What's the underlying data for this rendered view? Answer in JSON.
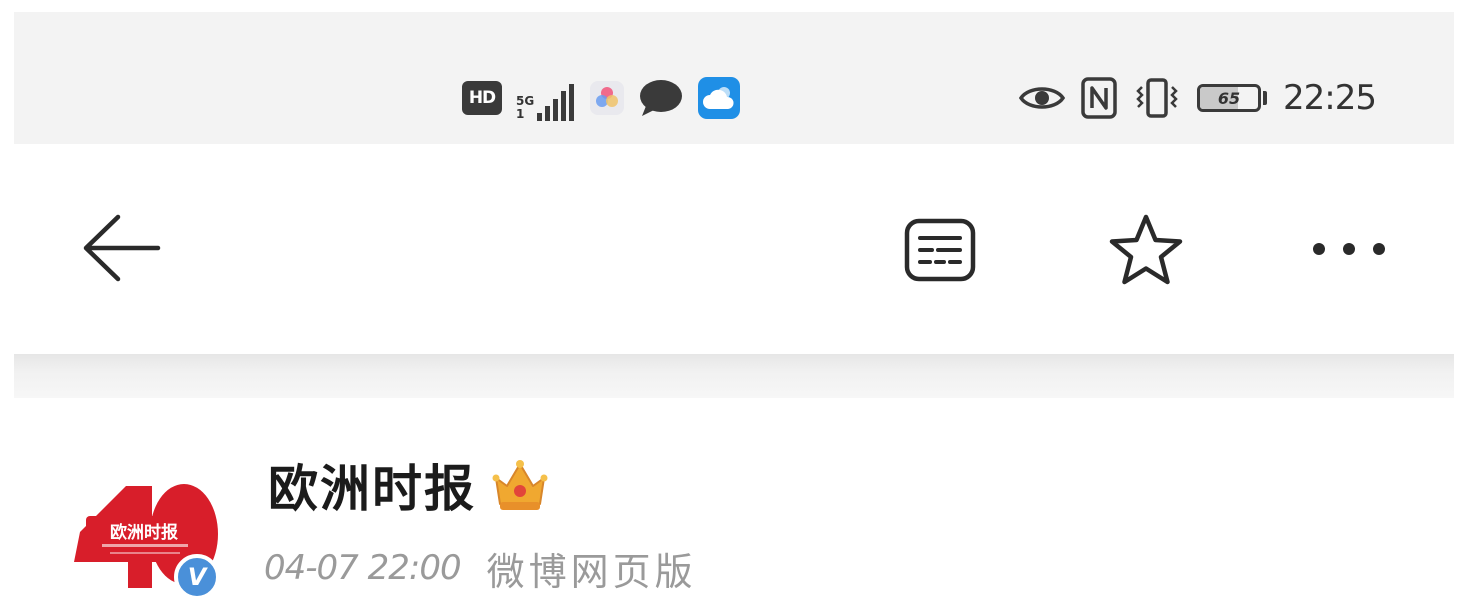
{
  "status_bar": {
    "hd_label": "HD",
    "network": {
      "type": "5G",
      "sub": "1",
      "signal_bars": 4,
      "max_bars": 5
    },
    "notification_icons": [
      "color-app-icon",
      "chat-bubble-icon",
      "weather-cloud-icon"
    ],
    "right_icons": [
      "eye-comfort-icon",
      "nfc-icon",
      "vibrate-icon"
    ],
    "battery": {
      "level_text": "65",
      "level_percent": 65
    },
    "time": "22:25",
    "colors": {
      "background": "#f3f3f3",
      "icon": "#3a3a3a",
      "weather_app": "#1f8fe6"
    }
  },
  "toolbar": {
    "icons": {
      "back": "arrow-left-icon",
      "reader": "reader-mode-icon",
      "favorite": "star-icon",
      "more": "more-dots-icon"
    }
  },
  "post": {
    "account_name": "欧洲时报",
    "avatar": {
      "logo_text": "欧洲时报",
      "anniversary_number": "40",
      "accent_color": "#d81e2a"
    },
    "verified_badge": "V",
    "crown_badge_icon": "crown-icon",
    "posted_at": "04-07 22:00",
    "source": "微博网页版",
    "colors": {
      "name": "#1b1b1b",
      "meta": "#9a9a9a",
      "verified": "#4a90d9",
      "crown": "#f0a830"
    }
  }
}
